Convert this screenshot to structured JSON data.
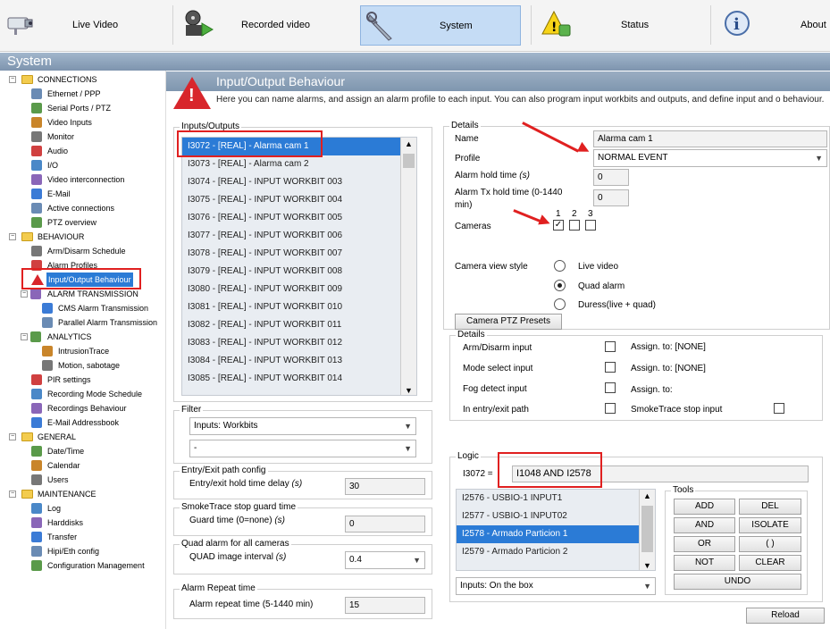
{
  "toolbar": {
    "items": [
      {
        "label": "Live Video",
        "icon": "camera-icon"
      },
      {
        "label": "Recorded video",
        "icon": "film-reel-icon"
      },
      {
        "label": "System",
        "icon": "wrench-icon"
      },
      {
        "label": "Status",
        "icon": "warning-lock-icon"
      },
      {
        "label": "About",
        "icon": "info-icon"
      }
    ]
  },
  "window_title": "System",
  "sidebar": {
    "items": [
      {
        "label": "CONNECTIONS",
        "type": "folder"
      },
      {
        "label": "Ethernet / PPP",
        "type": "item"
      },
      {
        "label": "Serial Ports / PTZ",
        "type": "item"
      },
      {
        "label": "Video Inputs",
        "type": "item"
      },
      {
        "label": "Monitor",
        "type": "item"
      },
      {
        "label": "Audio",
        "type": "item"
      },
      {
        "label": "I/O",
        "type": "item"
      },
      {
        "label": "Video interconnection",
        "type": "item"
      },
      {
        "label": "E-Mail",
        "type": "item"
      },
      {
        "label": "Active connections",
        "type": "item"
      },
      {
        "label": "PTZ overview",
        "type": "item"
      },
      {
        "label": "BEHAVIOUR",
        "type": "folder"
      },
      {
        "label": "Arm/Disarm Schedule",
        "type": "item"
      },
      {
        "label": "Alarm Profiles",
        "type": "item"
      },
      {
        "label": "Input/Output Behaviour",
        "type": "item",
        "selected": true
      },
      {
        "label": "ALARM TRANSMISSION",
        "type": "subfolder"
      },
      {
        "label": "CMS Alarm Transmission",
        "type": "subitem"
      },
      {
        "label": "Parallel Alarm Transmission",
        "type": "subitem"
      },
      {
        "label": "ANALYTICS",
        "type": "subfolder"
      },
      {
        "label": "IntrusionTrace",
        "type": "subitem"
      },
      {
        "label": "Motion, sabotage",
        "type": "subitem"
      },
      {
        "label": "PIR settings",
        "type": "item"
      },
      {
        "label": "Recording Mode Schedule",
        "type": "item"
      },
      {
        "label": "Recordings Behaviour",
        "type": "item"
      },
      {
        "label": "E-Mail Addressbook",
        "type": "item"
      },
      {
        "label": "GENERAL",
        "type": "folder"
      },
      {
        "label": "Date/Time",
        "type": "item"
      },
      {
        "label": "Calendar",
        "type": "item"
      },
      {
        "label": "Users",
        "type": "item"
      },
      {
        "label": "MAINTENANCE",
        "type": "folder"
      },
      {
        "label": "Log",
        "type": "item"
      },
      {
        "label": "Harddisks",
        "type": "item"
      },
      {
        "label": "Transfer",
        "type": "item"
      },
      {
        "label": "Hipi/Eth config",
        "type": "item"
      },
      {
        "label": "Configuration Management",
        "type": "item"
      }
    ]
  },
  "page": {
    "title": "Input/Output Behaviour",
    "description": "Here you can name alarms, and assign an alarm profile to each input. You can also program input workbits and outputs, and define input and o behaviour."
  },
  "io_list": {
    "label": "Inputs/Outputs",
    "items": [
      "I3072 - [REAL] - Alarma cam 1",
      "I3073 - [REAL] - Alarma cam 2",
      "I3074 - [REAL] - INPUT WORKBIT 003",
      "I3075 - [REAL] - INPUT WORKBIT 004",
      "I3076 - [REAL] - INPUT WORKBIT 005",
      "I3077 - [REAL] - INPUT WORKBIT 006",
      "I3078 - [REAL] - INPUT WORKBIT 007",
      "I3079 - [REAL] - INPUT WORKBIT 008",
      "I3080 - [REAL] - INPUT WORKBIT 009",
      "I3081 - [REAL] - INPUT WORKBIT 010",
      "I3082 - [REAL] - INPUT WORKBIT 011",
      "I3083 - [REAL] - INPUT WORKBIT 012",
      "I3084 - [REAL] - INPUT WORKBIT 013",
      "I3085 - [REAL] - INPUT WORKBIT 014"
    ],
    "selected_index": 0
  },
  "filter": {
    "label": "Filter",
    "select1": "Inputs: Workbits",
    "select2": "-"
  },
  "entry_exit": {
    "label": "Entry/Exit path config",
    "field_label": "Entry/exit hold time delay",
    "unit": "(s)",
    "value": "30"
  },
  "smoketrace": {
    "label": "SmokeTrace stop guard time",
    "field_label": "Guard time (0=none)",
    "unit": "(s)",
    "value": "0"
  },
  "quad": {
    "label": "Quad alarm for all cameras",
    "field_label": "QUAD image interval",
    "unit": "(s)",
    "value": "0.4"
  },
  "repeat": {
    "label": "Alarm Repeat time",
    "field_label": "Alarm repeat time (5-1440 min)",
    "value": "15"
  },
  "details": {
    "label": "Details",
    "name_label": "Name",
    "name_value": "Alarma cam 1",
    "profile_label": "Profile",
    "profile_value": "NORMAL EVENT",
    "hold_label": "Alarm hold time",
    "hold_unit": "(s)",
    "hold_value": "0",
    "tx_label": "Alarm Tx hold time (0-1440 min)",
    "tx_value": "0",
    "cameras_label": "Cameras",
    "camera_numbers": [
      "1",
      "2",
      "3"
    ],
    "camera_checked": [
      true,
      false,
      false
    ],
    "view_style_label": "Camera view style",
    "view_options": [
      "Live video",
      "Quad alarm",
      "Duress(live + quad)"
    ],
    "view_selected": 1,
    "ptz_button": "Camera PTZ Presets"
  },
  "details2": {
    "label": "Details",
    "rows": [
      {
        "label": "Arm/Disarm input",
        "assign": "Assign. to: [NONE]"
      },
      {
        "label": "Mode select input",
        "assign": "Assign. to: [NONE]"
      },
      {
        "label": "Fog detect input",
        "assign": "Assign. to:"
      },
      {
        "label": "In entry/exit path",
        "assign": "SmokeTrace stop input"
      }
    ]
  },
  "logic": {
    "label": "Logic",
    "expr_label": "I3072 =",
    "expr_value": "I1048 AND I2578",
    "items": [
      "I2576 - USBIO-1 INPUT1",
      "I2577 - USBIO-1 INPUT02",
      "I2578 - Armado Particion 1",
      "I2579 - Armado Particion 2"
    ],
    "selected_index": 2,
    "filter_value": "Inputs: On the box",
    "tools_label": "Tools",
    "tools": [
      "ADD",
      "DEL",
      "AND",
      "ISOLATE",
      "OR",
      "( )",
      "NOT",
      "CLEAR"
    ],
    "undo": "UNDO"
  },
  "reload_button": "Reload"
}
